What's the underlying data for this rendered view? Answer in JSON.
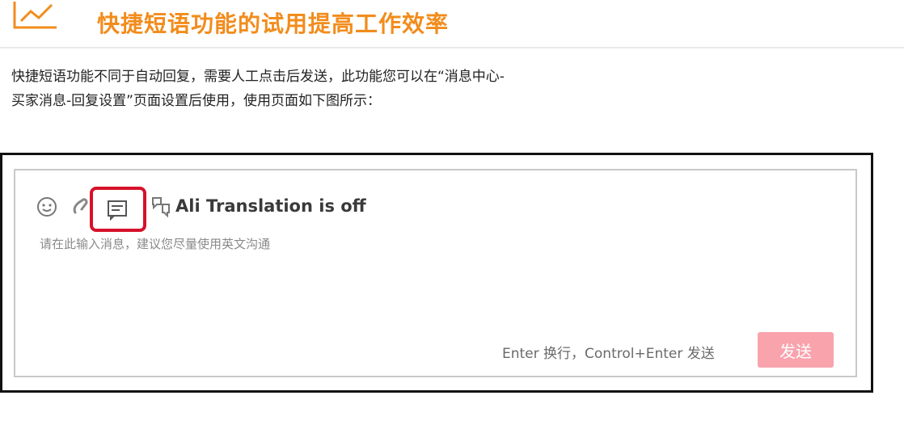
{
  "header": {
    "title": "快捷短语功能的试用提高工作效率",
    "icon": "chart-line-icon",
    "title_color": "#f28c1c"
  },
  "intro": {
    "line1": "快捷短语功能不同于自动回复，需要人工点击后发送，此功能您可以在“消息中心-",
    "line2": "买家消息-回复设置”页面设置后使用，使用页面如下图所示："
  },
  "chat_ui": {
    "toolbar": {
      "icons": [
        "emoji-icon",
        "attachment-icon",
        "quick-phrase-icon",
        "translate-icon"
      ],
      "translation_status": "Ali Translation is off",
      "highlight_color": "#d6112a"
    },
    "input": {
      "placeholder": "请在此输入消息，建议您尽量使用英文沟通"
    },
    "footer": {
      "hint": "Enter 换行，Control+Enter 发送",
      "send_label": "发送",
      "send_color": "#f9a3ad"
    }
  }
}
